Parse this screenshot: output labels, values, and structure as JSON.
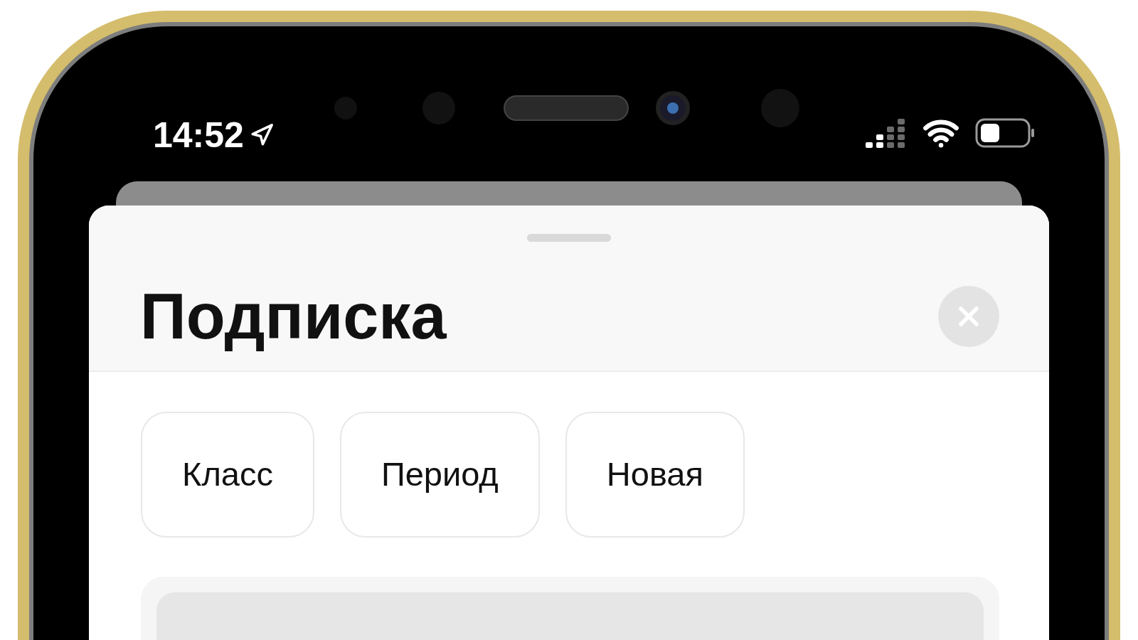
{
  "status_bar": {
    "time": "14:52"
  },
  "sheet": {
    "title": "Подписка",
    "filters": [
      {
        "label": "Класс"
      },
      {
        "label": "Период"
      },
      {
        "label": "Новая"
      }
    ]
  }
}
